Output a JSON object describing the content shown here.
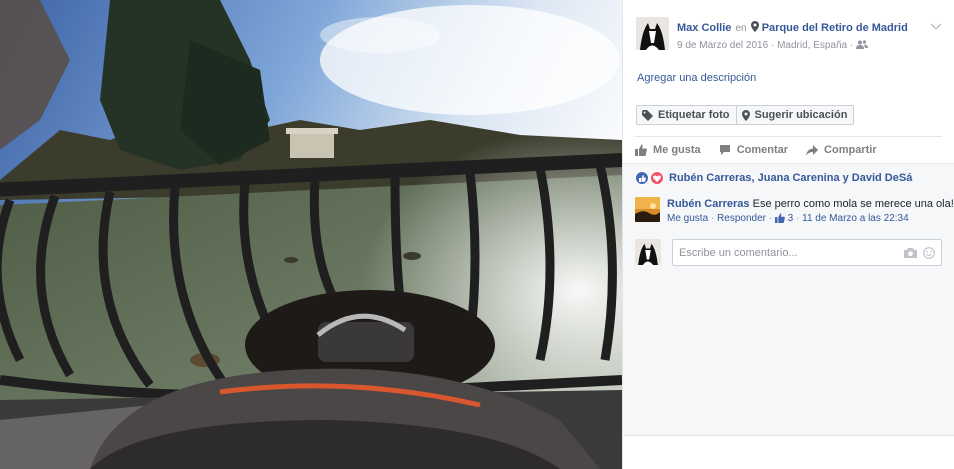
{
  "photo": {
    "icon": "photo-park-lake"
  },
  "post": {
    "author": "Max Collie",
    "connector": "en",
    "place": "Parque del Retiro de Madrid",
    "date": "9 de Marzo del 2016",
    "location": "Madrid, España",
    "sep": "·",
    "description_link": "Agregar una descripción",
    "tag_button": "Etiquetar foto",
    "suggest_button": "Sugerir ubicación"
  },
  "actions": {
    "like": "Me gusta",
    "comment": "Comentar",
    "share": "Compartir"
  },
  "reactions": {
    "names": "Rubén Carreras, Juana Carenina y David DeSá",
    "colors": {
      "like": "#4267b2",
      "love": "#f25268"
    }
  },
  "comment": {
    "author": "Rubén Carreras",
    "text": "Ese perro como mola se merece una ola!!!!",
    "like": "Me gusta",
    "reply": "Responder",
    "likes_count": "3",
    "timestamp": "11 de Marzo a las 22:34",
    "sep": "·"
  },
  "composer": {
    "placeholder": "Escribe un comentario...",
    "icons": [
      "camera-icon",
      "emoji-icon"
    ]
  },
  "colors": {
    "link": "#365899",
    "muted": "#90949c",
    "border": "#ccd0d5"
  }
}
